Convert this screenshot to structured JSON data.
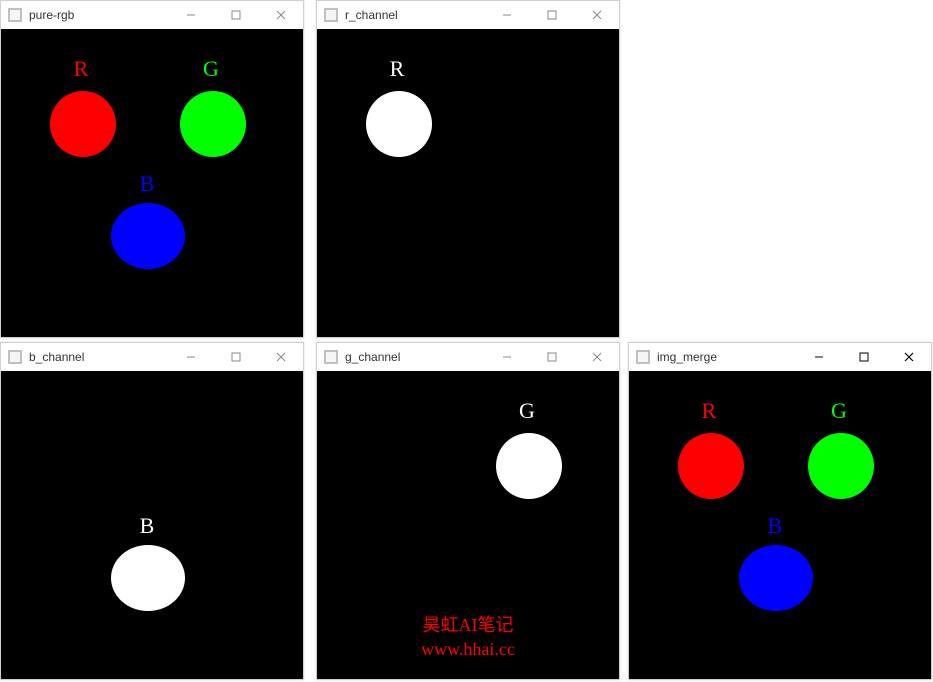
{
  "windows": {
    "w0": {
      "title": "pure-rgb"
    },
    "w1": {
      "title": "r_channel"
    },
    "w2": {
      "title": "b_channel"
    },
    "w3": {
      "title": "g_channel"
    },
    "w4": {
      "title": "img_merge"
    }
  },
  "labels": {
    "R": "R",
    "G": "G",
    "B": "B"
  },
  "watermark": {
    "line1": "昊虹AI笔记",
    "line2": "www.hhai.cc"
  },
  "colors": {
    "red": "#ff0000",
    "green": "#00ff00",
    "blue": "#0000ff",
    "white": "#ffffff",
    "black": "#000000"
  }
}
